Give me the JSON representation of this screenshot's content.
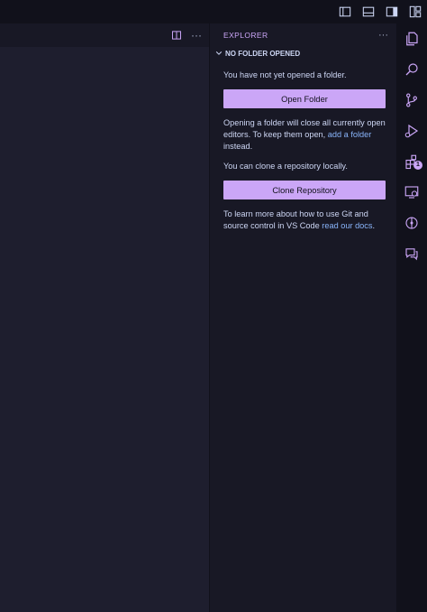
{
  "editor": {
    "more_actions_label": "···"
  },
  "sidebar": {
    "title": "EXPLORER",
    "more_label": "···",
    "section_title": "NO FOLDER OPENED",
    "welcome": {
      "line1": "You have not yet opened a folder.",
      "open_folder_button": "Open Folder",
      "line2_prefix": "Opening a folder will close all currently open editors. To keep them open, ",
      "line2_link": "add a folder",
      "line2_suffix": " instead.",
      "line3": "You can clone a repository locally.",
      "clone_button": "Clone Repository",
      "line4_prefix": "To learn more about how to use Git and source control in VS Code ",
      "line4_link": "read our docs",
      "line4_suffix": "."
    }
  },
  "activity_bar": {
    "extensions_badge": "1",
    "items": [
      "explorer-icon",
      "search-icon",
      "source-control-icon",
      "run-debug-icon",
      "extensions-icon",
      "remote-explorer-icon",
      "timeline-icon",
      "chat-icon"
    ]
  },
  "colors": {
    "accent": "#cba6f7",
    "link": "#89b4fa",
    "editor_bg": "#1e1e2e",
    "sidebar_bg": "#181825",
    "activity_bg": "#11111b"
  }
}
